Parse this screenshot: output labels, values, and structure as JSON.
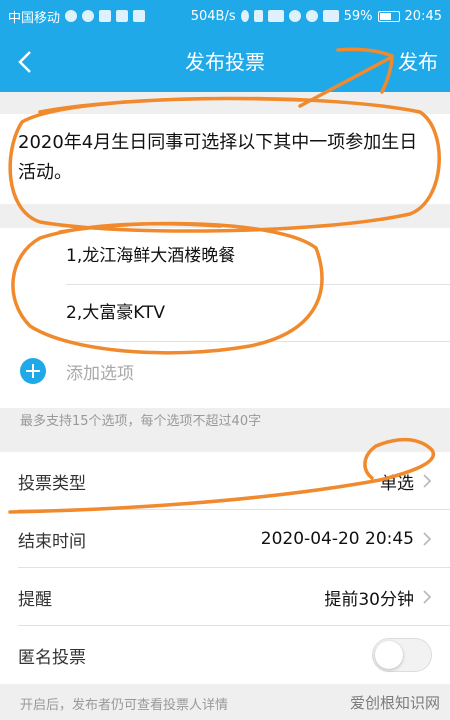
{
  "status_bar": {
    "carrier": "中国移动",
    "speed": "504B/s",
    "battery": "59%",
    "time": "20:45"
  },
  "nav": {
    "title": "发布投票",
    "publish_label": "发布"
  },
  "question": {
    "text": "2020年4月生日同事可选择以下其中一项参加生日活动。"
  },
  "options": [
    {
      "label": "1,龙江海鲜大酒楼晚餐"
    },
    {
      "label": "2,大富豪KTV"
    }
  ],
  "add_option": {
    "label": "添加选项"
  },
  "options_hint": "最多支持15个选项，每个选项不超过40字",
  "settings": [
    {
      "label": "投票类型",
      "value": "单选"
    },
    {
      "label": "结束时间",
      "value": "2020-04-20 20:45"
    },
    {
      "label": "提醒",
      "value": "提前30分钟"
    },
    {
      "label": "匿名投票",
      "toggle": false
    }
  ],
  "footer_hint": "开启后，发布者仍可查看投票人详情",
  "watermark": "爱创根知识网",
  "colors": {
    "accent": "#1fa9e8",
    "annotation": "#f08a2c"
  }
}
